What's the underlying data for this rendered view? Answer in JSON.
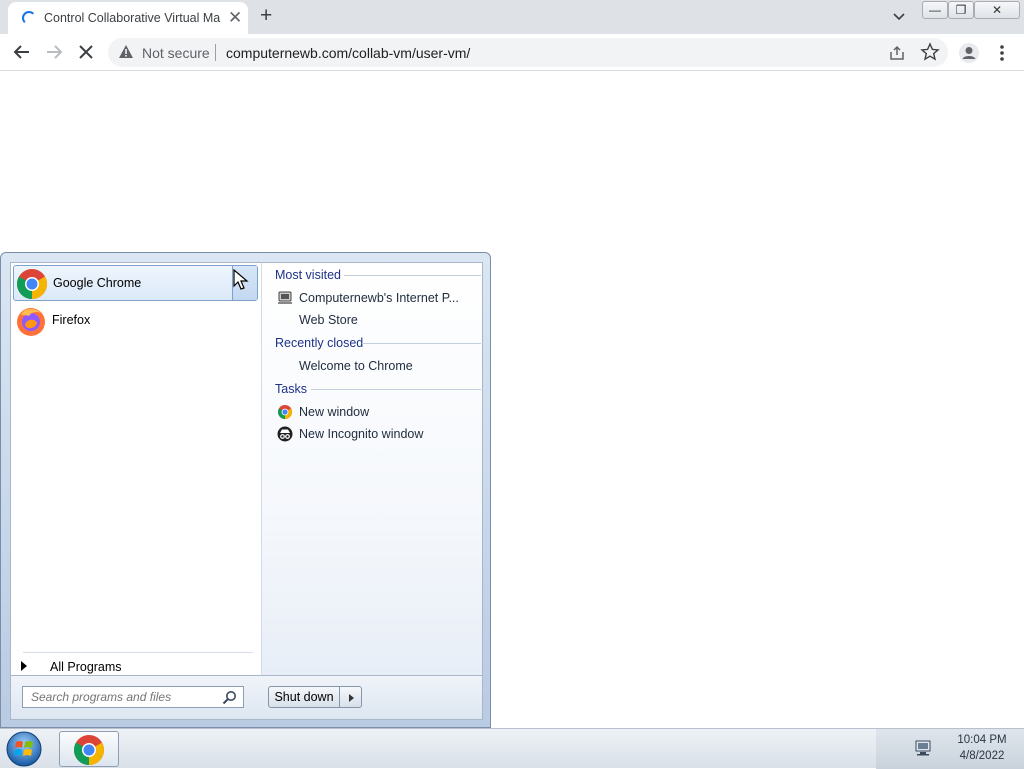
{
  "browser": {
    "tab_title": "Control Collaborative Virtual Ma",
    "new_tab": "+",
    "close_tab": "✕",
    "security_label": "Not secure",
    "url": "computernewb.com/collab-vm/user-vm/"
  },
  "start_menu": {
    "pinned_programs": [
      {
        "label": "Google Chrome",
        "icon": "chrome-icon"
      },
      {
        "label": "Firefox",
        "icon": "firefox-icon"
      }
    ],
    "all_programs_label": "All Programs",
    "jump_list": {
      "most_visited_heading": "Most visited",
      "most_visited": [
        {
          "label": "Computernewb's Internet P...",
          "icon": "computernewb-icon"
        },
        {
          "label": "Web Store",
          "icon": ""
        }
      ],
      "recently_closed_heading": "Recently closed",
      "recently_closed": [
        {
          "label": "Welcome to Chrome",
          "icon": ""
        }
      ],
      "tasks_heading": "Tasks",
      "tasks": [
        {
          "label": "New window",
          "icon": "chrome-icon"
        },
        {
          "label": "New Incognito window",
          "icon": "incognito-icon"
        }
      ]
    },
    "search_placeholder": "Search programs and files",
    "shutdown_label": "Shut down"
  },
  "taskbar": {
    "clock_time": "10:04 PM",
    "clock_date": "4/8/2022"
  },
  "colors": {
    "chrome_red": "#db4437",
    "chrome_green": "#0f9d58",
    "chrome_yellow": "#f4b400",
    "chrome_blue": "#4285f4",
    "link_heading_blue": "#1e3287"
  }
}
